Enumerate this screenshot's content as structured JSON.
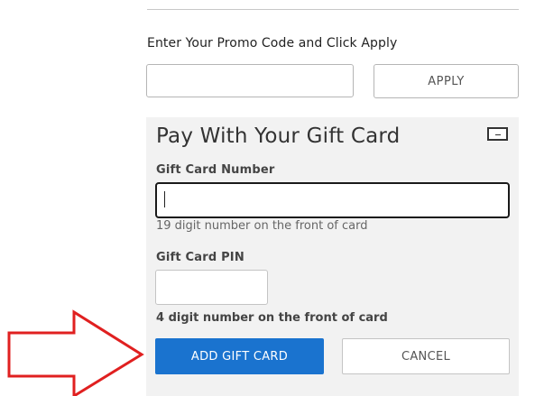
{
  "promo": {
    "label": "Enter Your Promo Code and Click Apply",
    "input_value": "",
    "apply_label": "APPLY"
  },
  "gift_card": {
    "title": "Pay With Your Gift Card",
    "icon": "gift-card-icon",
    "number_label": "Gift Card Number",
    "number_value": "",
    "number_hint": "19 digit number on the front of card",
    "pin_label": "Gift Card PIN",
    "pin_value": "",
    "pin_hint": "4 digit number on the front of card",
    "add_label": "ADD GIFT CARD",
    "cancel_label": "CANCEL"
  },
  "annotation": {
    "arrow_icon": "right-arrow-icon",
    "arrow_color": "#e02020"
  },
  "colors": {
    "primary_button": "#1a73cf",
    "panel_background": "#f2f2f2"
  }
}
